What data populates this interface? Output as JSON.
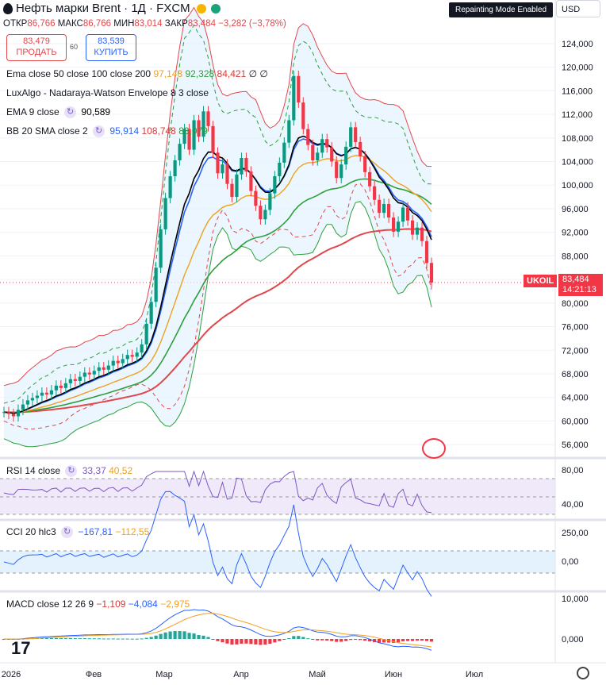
{
  "header": {
    "title": "Нефть марки Brent · 1Д · FXCM"
  },
  "ohlc": {
    "o_label": "ОТКР",
    "o": "86,766",
    "h_label": "МАКС",
    "h": "86,766",
    "l_label": "МИН",
    "l": "83,014",
    "c_label": "ЗАКР",
    "c": "83,484",
    "chg": "−3,282 (−3,78%)"
  },
  "trade": {
    "sell_price": "83,479",
    "sell_label": "ПРОДАТЬ",
    "spread": "60",
    "buy_price": "83,539",
    "buy_label": "КУПИТЬ"
  },
  "top_right": {
    "repaint": "Repainting Mode Enabled",
    "currency": "USD"
  },
  "indicators": {
    "ema_label": "Ema close 50 close 100 close 200",
    "ema50": "97,143",
    "ema100": "92,328",
    "ema200": "84,421",
    "ema_extra": "∅ ∅",
    "nw_label": "LuxAlgo - Nadaraya-Watson Envelope 8 3 close",
    "ema9_label": "EMA 9 close",
    "ema9": "90,589",
    "bb_label": "BB 20 SMA close 2",
    "bb_basis": "95,914",
    "bb_upper": "108,748",
    "bb_lower": "83,079",
    "rsi_label": "RSI 14 close",
    "rsi": "33,37",
    "rsi_ma": "40,52",
    "cci_label": "CCI 20 hlc3",
    "cci": "−167,81",
    "cci_ma": "−112,55",
    "macd_label": "MACD close 12 26 9",
    "macd_hist": "−1,109",
    "macd": "−4,084",
    "macd_signal": "−2,975"
  },
  "price_tag": {
    "symbol": "UKOIL",
    "price": "83,484",
    "timer": "14:21:13"
  },
  "colors": {
    "up": "#089981",
    "down": "#f23645",
    "ema50": "#f0a020",
    "ema100": "#2e9f3b",
    "ema200": "#e2474b",
    "ema9": "#000000",
    "bb": "#2962ff",
    "nw": "#e2474b"
  },
  "chart_data": {
    "type": "line",
    "title": "Нефть марки Brent · 1Д · FXCM",
    "x_ticks": [
      "2026",
      "Фев",
      "Мар",
      "Апр",
      "Май",
      "Июн",
      "Июл"
    ],
    "y_ticks": [
      "124,000",
      "120,000",
      "116,000",
      "112,000",
      "108,000",
      "104,000",
      "100,000",
      "96,000",
      "92,000",
      "88,000",
      "84,000",
      "80,000",
      "76,000",
      "72,000",
      "68,000",
      "64,000",
      "60,000",
      "56,000"
    ],
    "ylim": [
      54,
      126
    ],
    "close": [
      61.5,
      61.2,
      60.8,
      61.9,
      62.8,
      63.5,
      63.9,
      64.3,
      64.8,
      64.5,
      65.2,
      66.0,
      65.6,
      66.4,
      67.1,
      66.8,
      67.5,
      68.2,
      67.9,
      68.5,
      69.1,
      68.7,
      69.4,
      70.2,
      69.8,
      70.5,
      71.2,
      70.9,
      71.6,
      73.0,
      76.5,
      80.2,
      86.0,
      92.5,
      97.8,
      101.5,
      104.2,
      107.0,
      109.5,
      106.0,
      111.0,
      108.2,
      112.5,
      110.0,
      105.5,
      102.0,
      103.5,
      100.2,
      98.0,
      101.8,
      104.6,
      102.3,
      99.0,
      96.5,
      94.2,
      95.8,
      98.6,
      101.5,
      103.8,
      107.2,
      111.0,
      118.5,
      114.0,
      109.5,
      106.8,
      104.2,
      105.5,
      107.8,
      106.4,
      104.0,
      101.2,
      103.5,
      106.5,
      109.8,
      107.3,
      104.9,
      102.2,
      99.8,
      97.5,
      95.3,
      96.8,
      94.5,
      92.1,
      93.8,
      96.2,
      94.0,
      91.6,
      92.8,
      90.5,
      86.8,
      83.484
    ],
    "ema9_last": 90.589,
    "ema50_last": 97.143,
    "ema100_last": 92.328,
    "ema200_last": 84.421,
    "bb": {
      "basis": 95.914,
      "upper": 108.748,
      "lower": 83.079
    },
    "rsi": {
      "ticks": [
        "80,00",
        "40,00"
      ],
      "value": 33.37,
      "ma": 40.52
    },
    "cci": {
      "ticks": [
        "250,00",
        "0,00"
      ],
      "value": -167.81,
      "ma": -112.55
    },
    "macd": {
      "ticks": [
        "10,000",
        "0,000"
      ],
      "hist": -1.109,
      "macd": -4.084,
      "signal": -2.975
    }
  }
}
